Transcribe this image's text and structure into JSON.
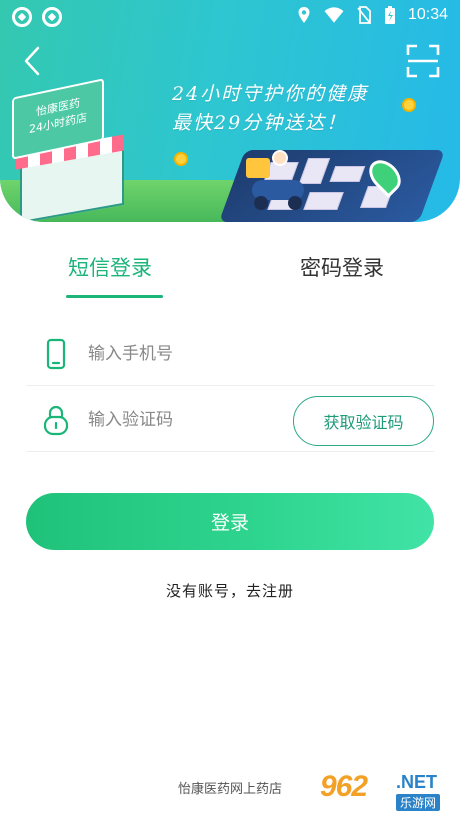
{
  "status_bar": {
    "time": "10:34",
    "icons": [
      "notification-icon",
      "notification-icon",
      "location-icon",
      "wifi-icon",
      "no-sim-icon",
      "battery-icon"
    ]
  },
  "header": {
    "slogan_line1": "24小时守护你的健康",
    "slogan_line2": "最快29分钟送达！",
    "store_sign_line1": "怡康医药",
    "store_sign_line2": "24小时药店",
    "back_icon": "chevron-left-icon",
    "scan_icon": "scan-icon"
  },
  "tabs": {
    "sms_login": "短信登录",
    "password_login": "密码登录",
    "active": "sms_login"
  },
  "form": {
    "phone_placeholder": "输入手机号",
    "code_placeholder": "输入验证码",
    "get_code_label": "获取验证码",
    "login_label": "登录",
    "register_link": "没有账号，去注册"
  },
  "footer": {
    "text": "怡康医药网上药店"
  },
  "watermark": {
    "brand_number": "962",
    "brand_suffix": ".NET",
    "brand_cn": "乐游网"
  },
  "colors": {
    "accent": "#1bb57a",
    "banner_start": "#34c8b0",
    "banner_end": "#25b9e8",
    "button_start": "#20c27a",
    "button_end": "#41e3a6"
  }
}
